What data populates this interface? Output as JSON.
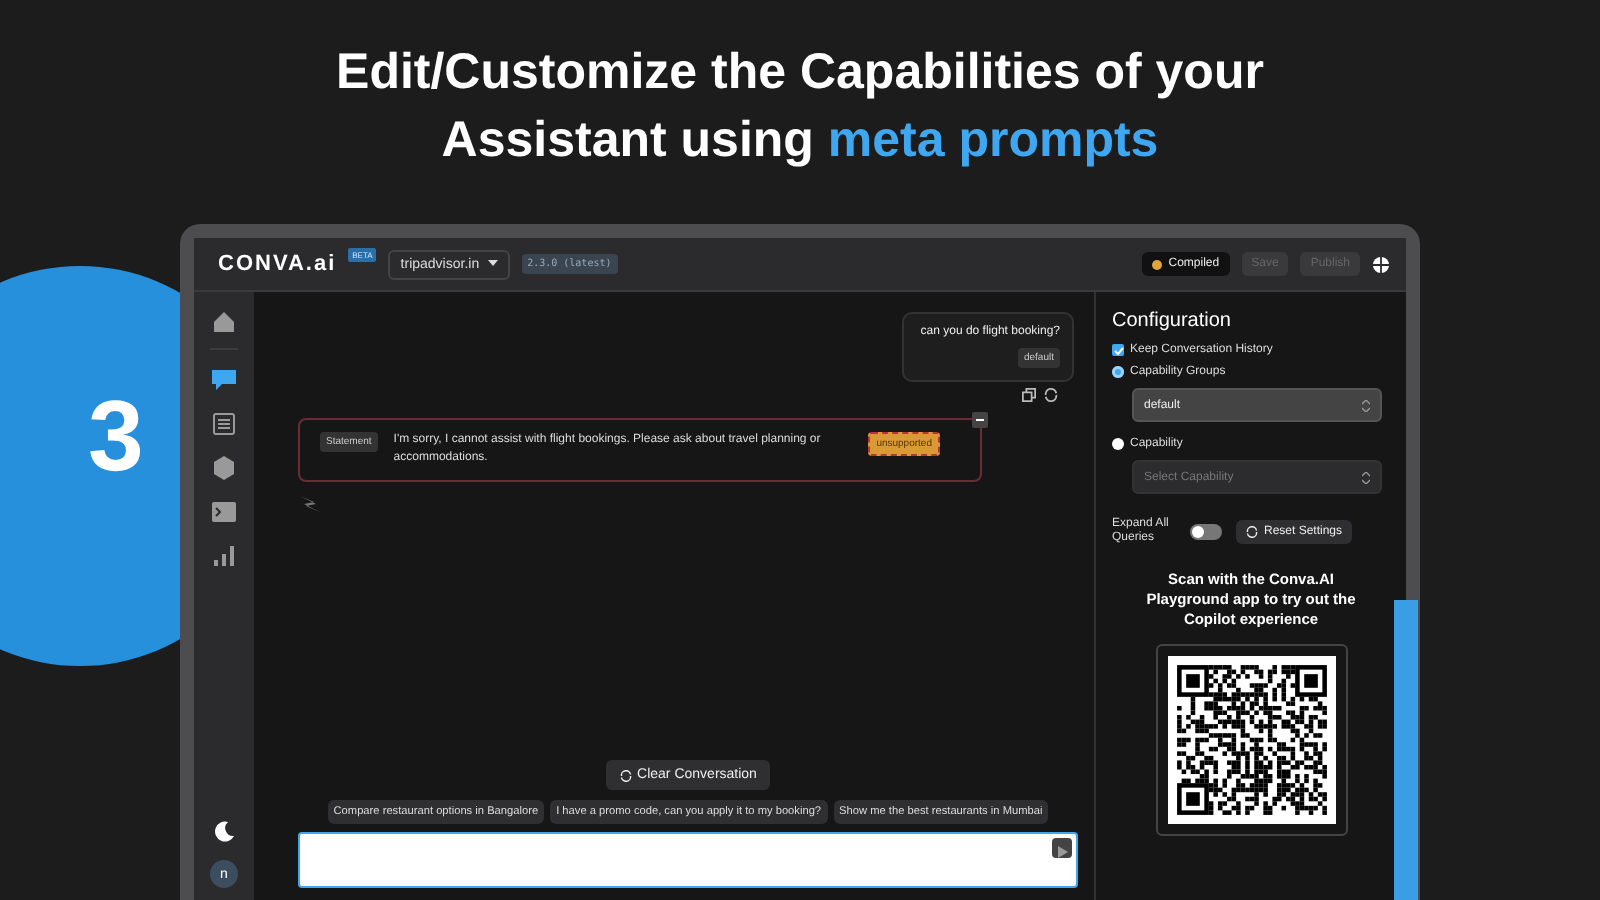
{
  "headline": {
    "text": "Edit/Customize the Capabilities of your Assistant using",
    "highlight": "meta prompts"
  },
  "step": {
    "number": "3"
  },
  "topbar": {
    "logo": "CONVA.ai",
    "badge": "BETA",
    "project": "tripadvisor.in",
    "version": "2.3.0 (latest)",
    "actions": [
      {
        "kind": "status",
        "label": "Compiled",
        "disabled": false
      },
      {
        "kind": "save",
        "label": "Save",
        "disabled": true
      },
      {
        "kind": "publish",
        "label": "Publish",
        "disabled": true
      }
    ]
  },
  "sidebar": {
    "items": [
      {
        "kind": "home",
        "selected": false
      },
      {
        "kind": "chat",
        "selected": true
      },
      {
        "kind": "list",
        "selected": false
      },
      {
        "kind": "cube",
        "selected": false
      },
      {
        "kind": "terminal",
        "selected": false
      },
      {
        "kind": "chart",
        "selected": false
      }
    ],
    "avatar": "n"
  },
  "chat": {
    "messages": [
      {
        "kind": "user",
        "text": "can you do flight booking?",
        "tag": "default"
      },
      {
        "kind": "assistant",
        "type_label": "Statement",
        "text": "I'm sorry, I cannot assist with flight bookings. Please ask about travel planning or accommodations.",
        "status": "unsupported"
      }
    ],
    "clear_button": "Clear Conversation",
    "suggestions": [
      "Compare restaurant options in Bangalore",
      "I have a promo code, can you apply it to my booking?",
      "Show me the best restaurants in Mumbai"
    ]
  },
  "config": {
    "title": "Configuration",
    "keep_history": {
      "label": "Keep Conversation History",
      "checked": true
    },
    "options": [
      {
        "label": "Capability Groups",
        "selected": true,
        "value": "default",
        "disabled": false
      },
      {
        "label": "Capability",
        "selected": false,
        "placeholder": "Select Capability",
        "disabled": true
      }
    ],
    "expand_all": {
      "label": "Expand All Queries",
      "on": false
    },
    "reset_button": "Reset Settings",
    "scan_text": "Scan with the Conva.AI Playground app to try out the Copilot experience"
  }
}
